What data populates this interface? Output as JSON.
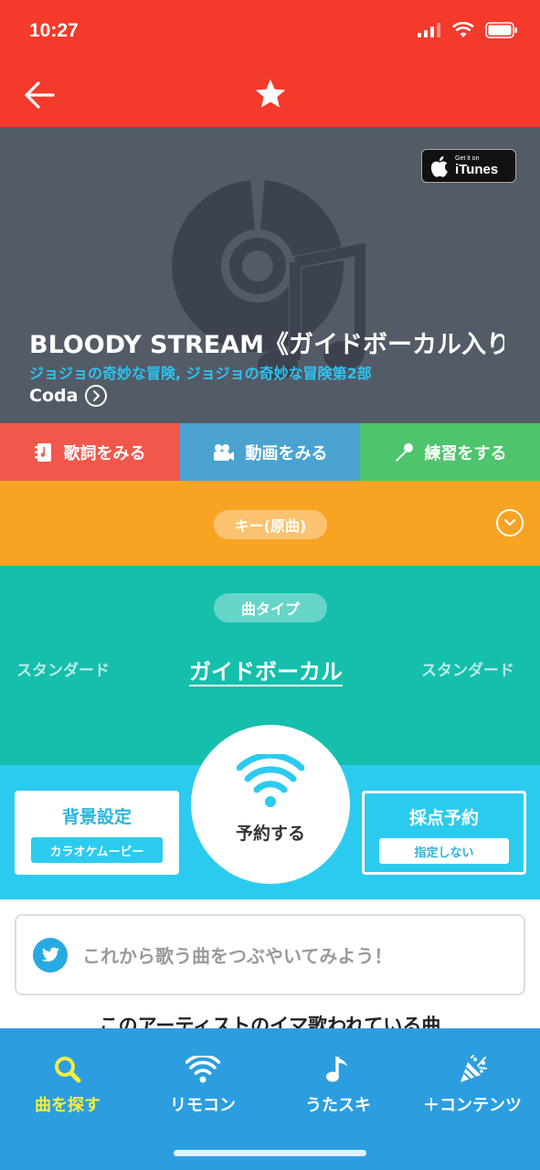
{
  "status_bar": {
    "time": "10:27"
  },
  "header": {
    "back_icon": "back-arrow-icon",
    "favorite_icon": "star-icon"
  },
  "hero": {
    "itunes_small": "Get it on",
    "itunes_big": "iTunes",
    "title": "BLOODY STREAM《ガイドボーカル入り》",
    "tieup": "ジョジョの奇妙な冒険, ジョジョの奇妙な冒険第2部",
    "artist": "Coda"
  },
  "actions": [
    {
      "label": "歌詞をみる",
      "icon": "lyrics-icon",
      "color": "#f1574b"
    },
    {
      "label": "動画をみる",
      "icon": "video-camera-icon",
      "color": "#4aa3cf"
    },
    {
      "label": "練習をする",
      "icon": "microphone-icon",
      "color": "#4ec46c"
    }
  ],
  "key_section": {
    "label": "キー(原曲)",
    "color": "#f9a323"
  },
  "type_section": {
    "label": "曲タイプ",
    "left_option": "スタンダード",
    "selected": "ガイドボーカル",
    "right_option": "スタンダード",
    "color": "#15bfab"
  },
  "remote": {
    "background_label": "背景設定",
    "background_value": "カラオケムービー",
    "reserve_label": "予約する",
    "score_label": "採点予約",
    "score_value": "指定しない",
    "color": "#2bcbef"
  },
  "tweet": {
    "placeholder": "これから歌う曲をつぶやいてみよう！"
  },
  "section_heading": "このアーティストのイマ歌われている曲",
  "tabbar": {
    "items": [
      {
        "label": "曲を探す",
        "icon": "search-icon",
        "active": true
      },
      {
        "label": "リモコン",
        "icon": "wifi-icon",
        "active": false
      },
      {
        "label": "うたスキ",
        "icon": "music-note-icon",
        "active": false
      },
      {
        "label": "＋コンテンツ",
        "icon": "party-popper-icon",
        "active": false
      }
    ],
    "color": "#2c9ee0",
    "active_color": "#f7ee3f"
  }
}
